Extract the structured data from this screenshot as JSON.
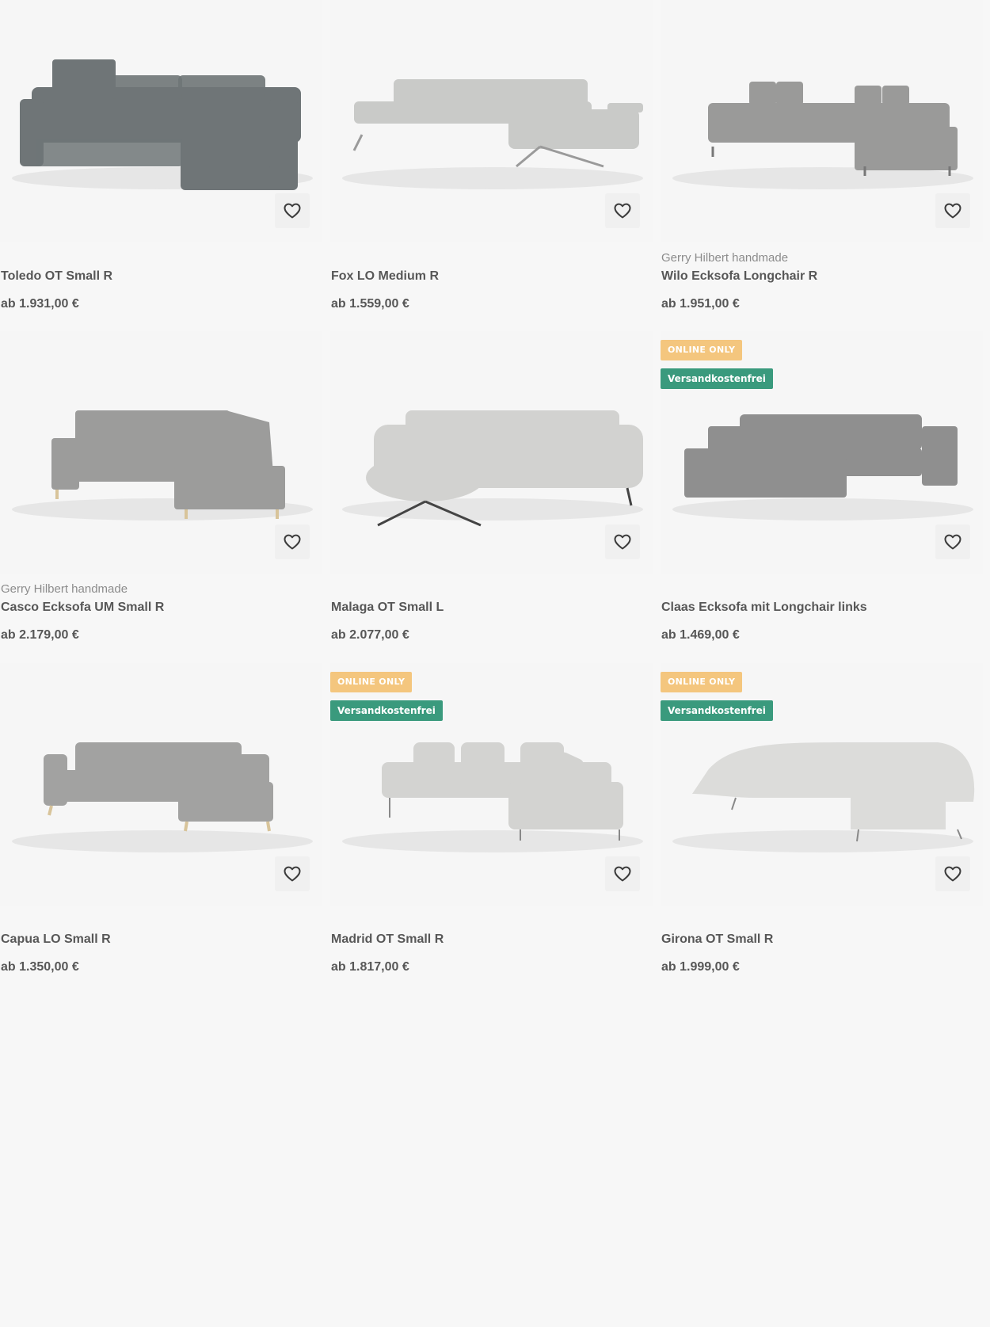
{
  "products": [
    {
      "brand": "",
      "name": "Toledo OT Small R",
      "price": "ab 1.931,00 €",
      "badges": [],
      "color": "#6f7577"
    },
    {
      "brand": "",
      "name": "Fox LO Medium R",
      "price": "ab 1.559,00 €",
      "badges": [],
      "color": "#c9cac8"
    },
    {
      "brand": "Gerry Hilbert handmade",
      "name": "Wilo Ecksofa Longchair R",
      "price": "ab 1.951,00 €",
      "badges": [],
      "color": "#9a9a99"
    },
    {
      "brand": "Gerry Hilbert handmade",
      "name": "Casco Ecksofa UM Small R",
      "price": "ab 2.179,00 €",
      "badges": [],
      "color": "#9c9c9b"
    },
    {
      "brand": "",
      "name": "Malaga OT Small L",
      "price": "ab 2.077,00 €",
      "badges": [],
      "color": "#d2d2d0"
    },
    {
      "brand": "",
      "name": "Claas Ecksofa mit Longchair links",
      "price": "ab 1.469,00 €",
      "badges": [
        "ONLINE ONLY",
        "Versandkostenfrei"
      ],
      "color": "#8f8f8f"
    },
    {
      "brand": "",
      "name": "Capua LO Small R",
      "price": "ab 1.350,00 €",
      "badges": [],
      "color": "#a2a2a1"
    },
    {
      "brand": "",
      "name": "Madrid OT Small R",
      "price": "ab 1.817,00 €",
      "badges": [
        "ONLINE ONLY",
        "Versandkostenfrei"
      ],
      "color": "#d3d3d1"
    },
    {
      "brand": "",
      "name": "Girona OT Small R",
      "price": "ab 1.999,00 €",
      "badges": [
        "ONLINE ONLY",
        "Versandkostenfrei"
      ],
      "color": "#dcdcda"
    }
  ],
  "colors": {
    "online_badge": "#f4c67e",
    "free_badge": "#3a9a7d",
    "background": "#f7f7f7"
  },
  "icons": {
    "favorite": "heart-icon"
  }
}
